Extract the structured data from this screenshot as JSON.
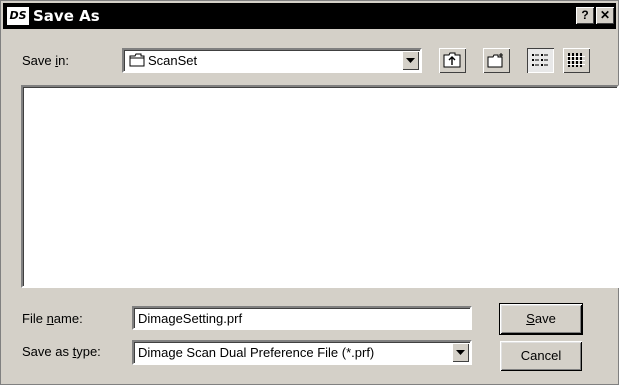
{
  "window": {
    "title": "Save As",
    "app_icon_text": "DS",
    "help_glyph": "?",
    "close_glyph": "✕"
  },
  "save_in": {
    "label_pre": "Save ",
    "label_hot": "i",
    "label_post": "n:",
    "value": "ScanSet",
    "icon": "folder-icon"
  },
  "toolbar": {
    "buttons": [
      "up-one-level-icon",
      "new-folder-icon",
      "list-view-icon",
      "details-view-icon"
    ]
  },
  "file_name": {
    "label_pre": "File ",
    "label_hot": "n",
    "label_post": "ame:",
    "value": "DimageSetting.prf"
  },
  "save_as_type": {
    "label_pre": "Save as ",
    "label_hot": "t",
    "label_post": "ype:",
    "value": "Dimage Scan Dual Preference File (*.prf)"
  },
  "buttons": {
    "save_hot": "S",
    "save_rest": "ave",
    "cancel": "Cancel"
  },
  "colors": {
    "face": "#d4d0c8",
    "titlebar": "#000000",
    "list_bg": "#ffffff"
  }
}
